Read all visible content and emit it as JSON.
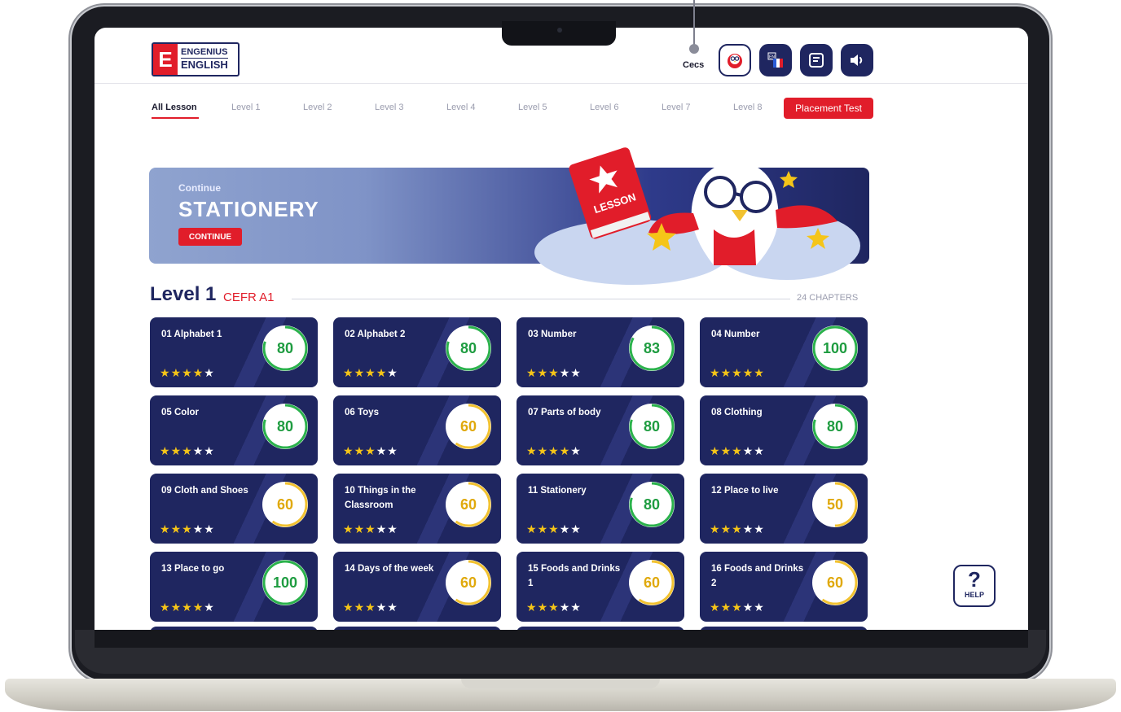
{
  "header": {
    "logo_top": "ENGENIUS",
    "logo_bottom": "ENGLISH",
    "logo_mark": "E",
    "user_name": "Cecs",
    "buttons": [
      {
        "name": "avatar-icon"
      },
      {
        "name": "language-flag-icon"
      },
      {
        "name": "notes-icon"
      },
      {
        "name": "speaker-icon"
      }
    ]
  },
  "tabs": {
    "items": [
      "All Lesson",
      "Level 1",
      "Level 2",
      "Level 3",
      "Level 4",
      "Level 5",
      "Level 6",
      "Level 7",
      "Level 8"
    ],
    "active": "All Lesson",
    "placement_label": "Placement Test"
  },
  "banner": {
    "continue_label": "Continue",
    "title": "STATIONERY",
    "button_label": "CONTINUE",
    "book_label": "LESSON"
  },
  "level": {
    "title": "Level 1",
    "cefr": "CEFR A1",
    "chapters": "24 CHAPTERS"
  },
  "lessons": [
    {
      "title": "01 Alphabet 1",
      "score": 80,
      "stars": 4
    },
    {
      "title": "02 Alphabet 2",
      "score": 80,
      "stars": 4
    },
    {
      "title": "03 Number",
      "score": 83,
      "stars": 3
    },
    {
      "title": "04 Number",
      "score": 100,
      "stars": 5
    },
    {
      "title": "05 Color",
      "score": 80,
      "stars": 3
    },
    {
      "title": "06 Toys",
      "score": 60,
      "stars": 3
    },
    {
      "title": "07 Parts of body",
      "score": 80,
      "stars": 4
    },
    {
      "title": "08 Clothing",
      "score": 80,
      "stars": 3
    },
    {
      "title": "09 Cloth and Shoes",
      "score": 60,
      "stars": 3
    },
    {
      "title": "10 Things in the Classroom",
      "score": 60,
      "stars": 3
    },
    {
      "title": "11 Stationery",
      "score": 80,
      "stars": 3
    },
    {
      "title": "12 Place to live",
      "score": 50,
      "stars": 3
    },
    {
      "title": "13 Place to go",
      "score": 100,
      "stars": 4
    },
    {
      "title": "14 Days of the week",
      "score": 60,
      "stars": 3
    },
    {
      "title": "15 Foods and Drinks 1",
      "score": 60,
      "stars": 3
    },
    {
      "title": "16 Foods and Drinks 2",
      "score": 60,
      "stars": 3
    }
  ],
  "help": {
    "symbol": "?",
    "label": "HELP"
  },
  "colors": {
    "navy": "#1f2660",
    "red": "#e11d2a",
    "green_ring": "#2bb24c",
    "yellow_ring": "#f2c230",
    "star": "#f5c518"
  }
}
